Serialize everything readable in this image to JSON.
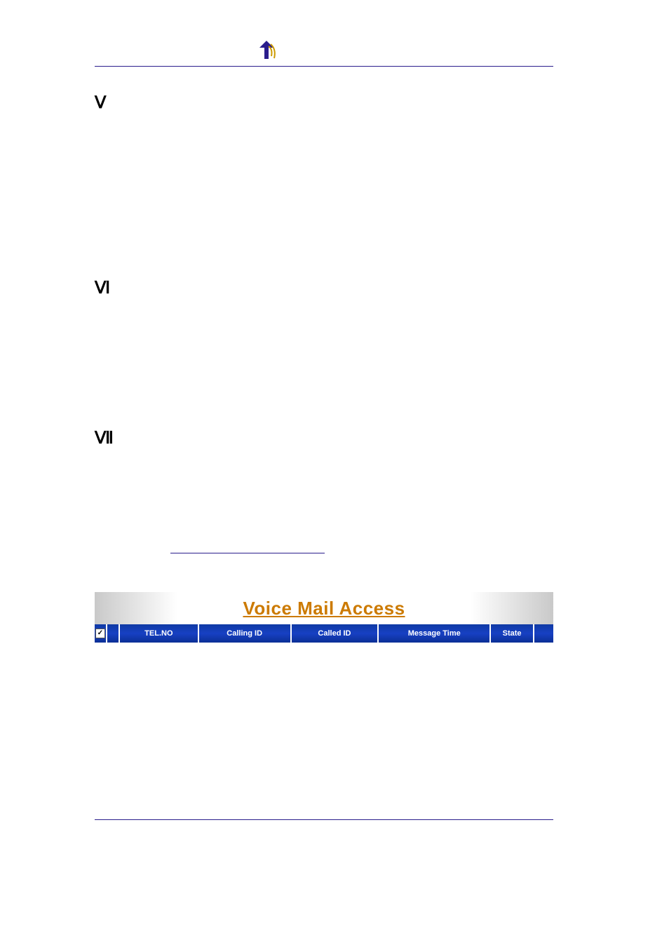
{
  "sections": [
    {
      "numeral": "Ⅴ"
    },
    {
      "numeral": "Ⅵ"
    },
    {
      "numeral": "Ⅶ"
    }
  ],
  "voicemail": {
    "title": "Voice Mail Access",
    "columns": {
      "tel": "TEL.NO",
      "calling": "Calling ID",
      "called": "Called ID",
      "time": "Message Time",
      "state": "State"
    }
  }
}
